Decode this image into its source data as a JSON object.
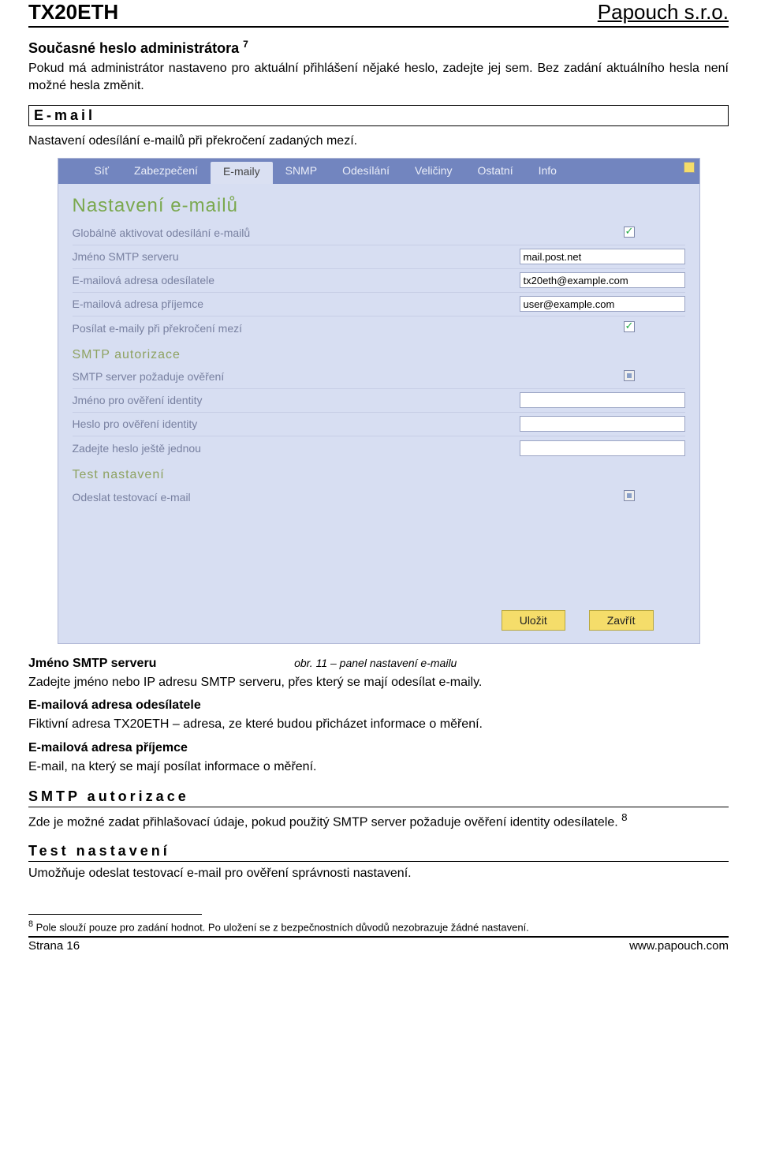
{
  "header": {
    "product": "TX20ETH",
    "company": "Papouch s.r.o."
  },
  "sec1": {
    "title": "Současné heslo administrátora",
    "sup": "7",
    "para": "Pokud má administrátor nastaveno pro aktuální přihlášení nějaké heslo, zadejte jej sem. Bez zadání aktuálního hesla není možné hesla změnit."
  },
  "email_heading": "E-mail",
  "email_intro": "Nastavení odesílání e-mailů při překročení zadaných mezí.",
  "screenshot": {
    "tabs": [
      "Síť",
      "Zabezpečení",
      "E-maily",
      "SNMP",
      "Odesílání",
      "Veličiny",
      "Ostatní",
      "Info"
    ],
    "active_tab_index": 2,
    "panel_title": "Nastavení e-mailů",
    "rows_main": [
      {
        "label": "Globálně aktivovat odesílání e-mailů",
        "type": "checkbox",
        "checked": true
      },
      {
        "label": "Jméno SMTP serveru",
        "type": "text",
        "value": "mail.post.net"
      },
      {
        "label": "E-mailová adresa odesílatele",
        "type": "text",
        "value": "tx20eth@example.com"
      },
      {
        "label": "E-mailová adresa příjemce",
        "type": "text",
        "value": "user@example.com"
      },
      {
        "label": "Posílat e-maily při překročení mezí",
        "type": "checkbox",
        "checked": true
      }
    ],
    "auth_title": "SMTP autorizace",
    "rows_auth": [
      {
        "label": "SMTP server požaduje ověření",
        "type": "checkbox_ind"
      },
      {
        "label": "Jméno pro ověření identity",
        "type": "text",
        "value": ""
      },
      {
        "label": "Heslo pro ověření identity",
        "type": "text",
        "value": ""
      },
      {
        "label": "Zadejte heslo ještě jednou",
        "type": "text",
        "value": ""
      }
    ],
    "test_title": "Test nastavení",
    "rows_test": [
      {
        "label": "Odeslat testovací e-mail",
        "type": "checkbox_ind"
      }
    ],
    "btn_save": "Uložit",
    "btn_close": "Zavřít"
  },
  "caption": "obr. 11 – panel nastavení e-mailu",
  "smtp_name_title": "Jméno SMTP serveru",
  "smtp_name_para": "Zadejte jméno nebo IP adresu SMTP serveru, přes který se mají odesílat e-maily.",
  "sender_title": "E-mailová adresa odesílatele",
  "sender_para": "Fiktivní adresa TX20ETH – adresa, ze které budou přicházet informace o měření.",
  "recipient_title": "E-mailová adresa příjemce",
  "recipient_para": "E-mail, na který se mají posílat informace o měření.",
  "auth_heading": "SMTP autorizace",
  "auth_para": "Zde je možné zadat přihlašovací údaje, pokud použitý SMTP server požaduje ověření identity odesílatele.",
  "auth_sup": "8",
  "test_heading": "Test nastavení",
  "test_para": "Umožňuje odeslat testovací e-mail pro ověření správnosti nastavení.",
  "footnote": {
    "sup": "8",
    "text": " Pole slouží pouze pro zadání hodnot. Po uložení se z bezpečnostních důvodů nezobrazuje žádné nastavení."
  },
  "footer": {
    "page": "Strana 16",
    "url": "www.papouch.com"
  }
}
